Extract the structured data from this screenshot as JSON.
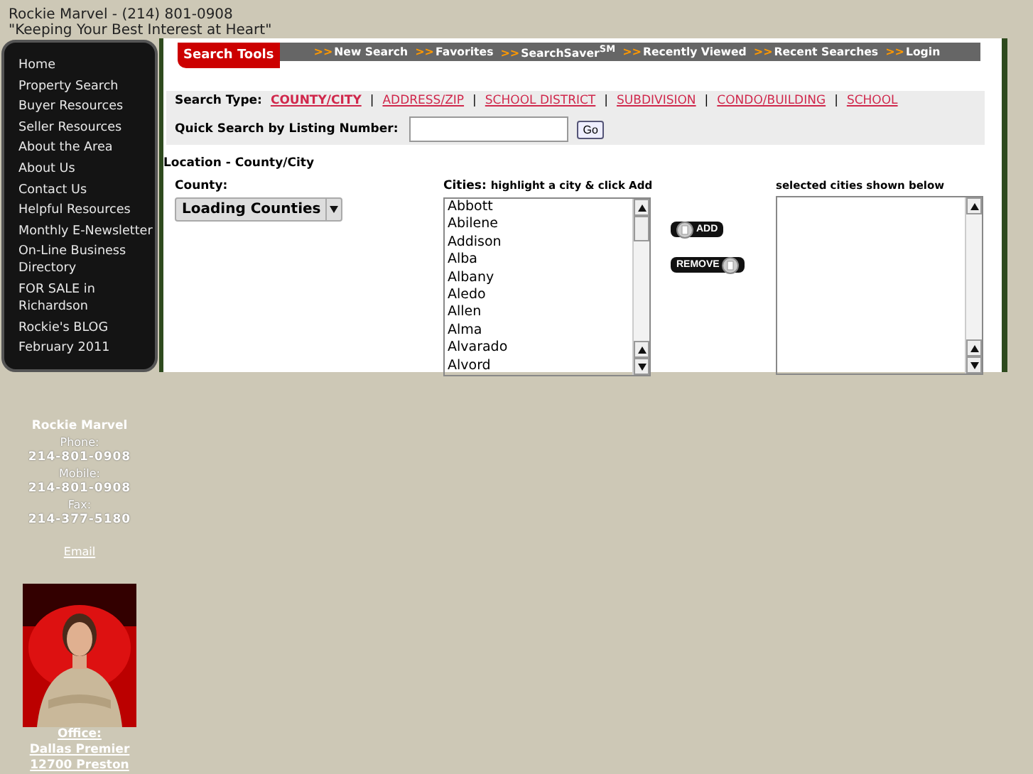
{
  "header": {
    "name_line": "Rockie Marvel - (214) 801-0908",
    "tagline": "\"Keeping Your Best Interest at Heart\""
  },
  "sidebar": {
    "items": [
      {
        "label": "Home"
      },
      {
        "label": "Property Search"
      },
      {
        "label": "Buyer Resources"
      },
      {
        "label": "Seller Resources"
      },
      {
        "label": "About the Area"
      },
      {
        "label": "About Us"
      },
      {
        "label": "Contact Us"
      },
      {
        "label": "Helpful Resources"
      },
      {
        "label": "Monthly E-Newsletter"
      },
      {
        "label": "On-Line Business Directory"
      },
      {
        "label": "FOR SALE in Richardson"
      },
      {
        "label": "Rockie's BLOG"
      },
      {
        "label": "February 2011"
      }
    ]
  },
  "contact": {
    "name": "Rockie Marvel",
    "lines": [
      {
        "kind": "label",
        "text": "Phone:"
      },
      {
        "kind": "value",
        "text": "214-801-0908"
      },
      {
        "kind": "label",
        "text": "Mobile:"
      },
      {
        "kind": "value",
        "text": "214-801-0908"
      },
      {
        "kind": "label",
        "text": "Fax:"
      },
      {
        "kind": "value",
        "text": "214-377-5180"
      }
    ],
    "email": "Email",
    "office": [
      "Office:",
      "Dallas Premier",
      "12700 Preston"
    ]
  },
  "search_tools": {
    "title": "Search Tools",
    "nav": [
      {
        "label": "New Search"
      },
      {
        "label": "Favorites"
      },
      {
        "label": "SearchSaver$^{SM}$"
      },
      {
        "label": "Recently Viewed"
      },
      {
        "label": "Recent Searches"
      },
      {
        "label": "Login"
      }
    ],
    "nav_marker": ">>"
  },
  "search_type": {
    "label": "Search Type:",
    "options": [
      {
        "label": "COUNTY/CITY",
        "selected": true
      },
      {
        "label": "ADDRESS/ZIP",
        "selected": false
      },
      {
        "label": "SCHOOL DISTRICT",
        "selected": false
      },
      {
        "label": "SUBDIVISION",
        "selected": false
      },
      {
        "label": "CONDO/BUILDING",
        "selected": false
      },
      {
        "label": "SCHOOL",
        "selected": false
      }
    ],
    "separator": "|"
  },
  "quick_search": {
    "label": "Quick Search by Listing Number:",
    "button": "Go"
  },
  "location": {
    "title": "Location - County/City",
    "county_label": "County:",
    "county_value": "Loading Counties",
    "cities_label": "Cities:",
    "cities_hint": "highlight a city & click Add",
    "cities": [
      "Abbott",
      "Abilene",
      "Addison",
      "Alba",
      "Albany",
      "Aledo",
      "Allen",
      "Alma",
      "Alvarado",
      "Alvord"
    ],
    "add_button": "ADD",
    "remove_button": "REMOVE",
    "selected_label": "selected cities shown below"
  }
}
